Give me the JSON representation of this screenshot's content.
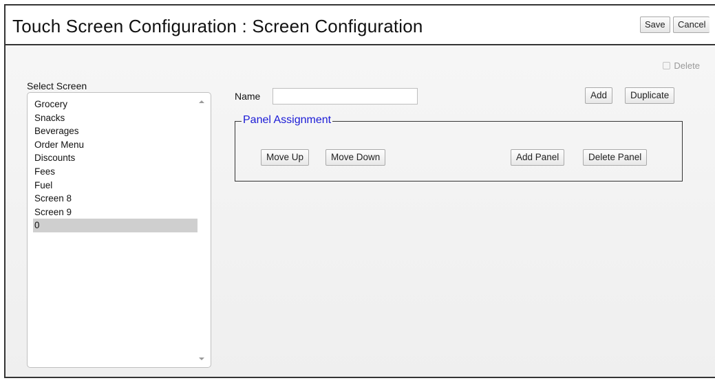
{
  "header": {
    "title": "Touch Screen Configuration : Screen Configuration",
    "save_label": "Save",
    "cancel_label": "Cancel"
  },
  "delete_option": {
    "label": "Delete",
    "checked": false
  },
  "screen_list": {
    "label": "Select Screen",
    "items": [
      "Grocery",
      "Snacks",
      "Beverages",
      "Order Menu",
      "Discounts",
      "Fees",
      "Fuel",
      "Screen 8",
      "Screen 9",
      "0"
    ],
    "selected_index": 9
  },
  "name_field": {
    "label": "Name",
    "value": ""
  },
  "actions": {
    "add_label": "Add",
    "duplicate_label": "Duplicate"
  },
  "panel_assignment": {
    "legend": "Panel Assignment",
    "move_up_label": "Move Up",
    "move_down_label": "Move Down",
    "add_panel_label": "Add Panel",
    "delete_panel_label": "Delete Panel"
  },
  "colors": {
    "legend_text": "#1a1ad6",
    "selected_row": "#cfcfcf",
    "content_background": "#f3f3f3"
  }
}
